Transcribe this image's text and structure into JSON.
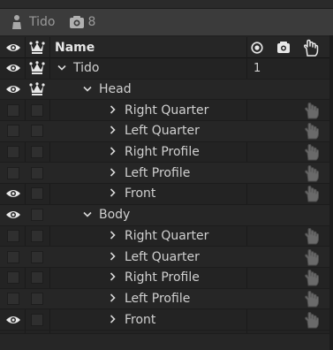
{
  "title_bar": {
    "puppet_name": "Tido",
    "camera_count": "8",
    "puppet_icon": "puppet-icon",
    "camera_icon": "camera-icon"
  },
  "header": {
    "name_label": "Name",
    "icons": [
      "eye-icon",
      "crown-icon",
      "record-icon",
      "camera-icon",
      "hand-icon"
    ]
  },
  "rows": [
    {
      "label": "Tido",
      "level": 0,
      "expanded": true,
      "eye": true,
      "crown": true,
      "value": "1",
      "hand": false
    },
    {
      "label": "Head",
      "level": 1,
      "expanded": true,
      "eye": true,
      "crown": true,
      "value": "",
      "hand": false
    },
    {
      "label": "Right Quarter",
      "level": 2,
      "expanded": false,
      "eye": false,
      "crown": false,
      "value": "",
      "hand": true
    },
    {
      "label": "Left Quarter",
      "level": 2,
      "expanded": false,
      "eye": false,
      "crown": false,
      "value": "",
      "hand": true
    },
    {
      "label": "Right Profile",
      "level": 2,
      "expanded": false,
      "eye": false,
      "crown": false,
      "value": "",
      "hand": true
    },
    {
      "label": "Left Profile",
      "level": 2,
      "expanded": false,
      "eye": false,
      "crown": false,
      "value": "",
      "hand": true
    },
    {
      "label": "Front",
      "level": 2,
      "expanded": false,
      "eye": true,
      "crown": false,
      "value": "",
      "hand": true
    },
    {
      "label": "Body",
      "level": 1,
      "expanded": true,
      "eye": true,
      "crown": false,
      "value": "",
      "hand": false
    },
    {
      "label": "Right Quarter",
      "level": 2,
      "expanded": false,
      "eye": false,
      "crown": false,
      "value": "",
      "hand": true
    },
    {
      "label": "Left Quarter",
      "level": 2,
      "expanded": false,
      "eye": false,
      "crown": false,
      "value": "",
      "hand": true
    },
    {
      "label": "Right Profile",
      "level": 2,
      "expanded": false,
      "eye": false,
      "crown": false,
      "value": "",
      "hand": true
    },
    {
      "label": "Left Profile",
      "level": 2,
      "expanded": false,
      "eye": false,
      "crown": false,
      "value": "",
      "hand": true
    },
    {
      "label": "Front",
      "level": 2,
      "expanded": false,
      "eye": true,
      "crown": false,
      "value": "",
      "hand": true
    }
  ],
  "colors": {
    "background": "#232323",
    "title_bar": "#3b3b3b",
    "text": "#d0d0d0",
    "icon_light": "#e8e8e8",
    "icon_dim": "#6a6a6a"
  }
}
